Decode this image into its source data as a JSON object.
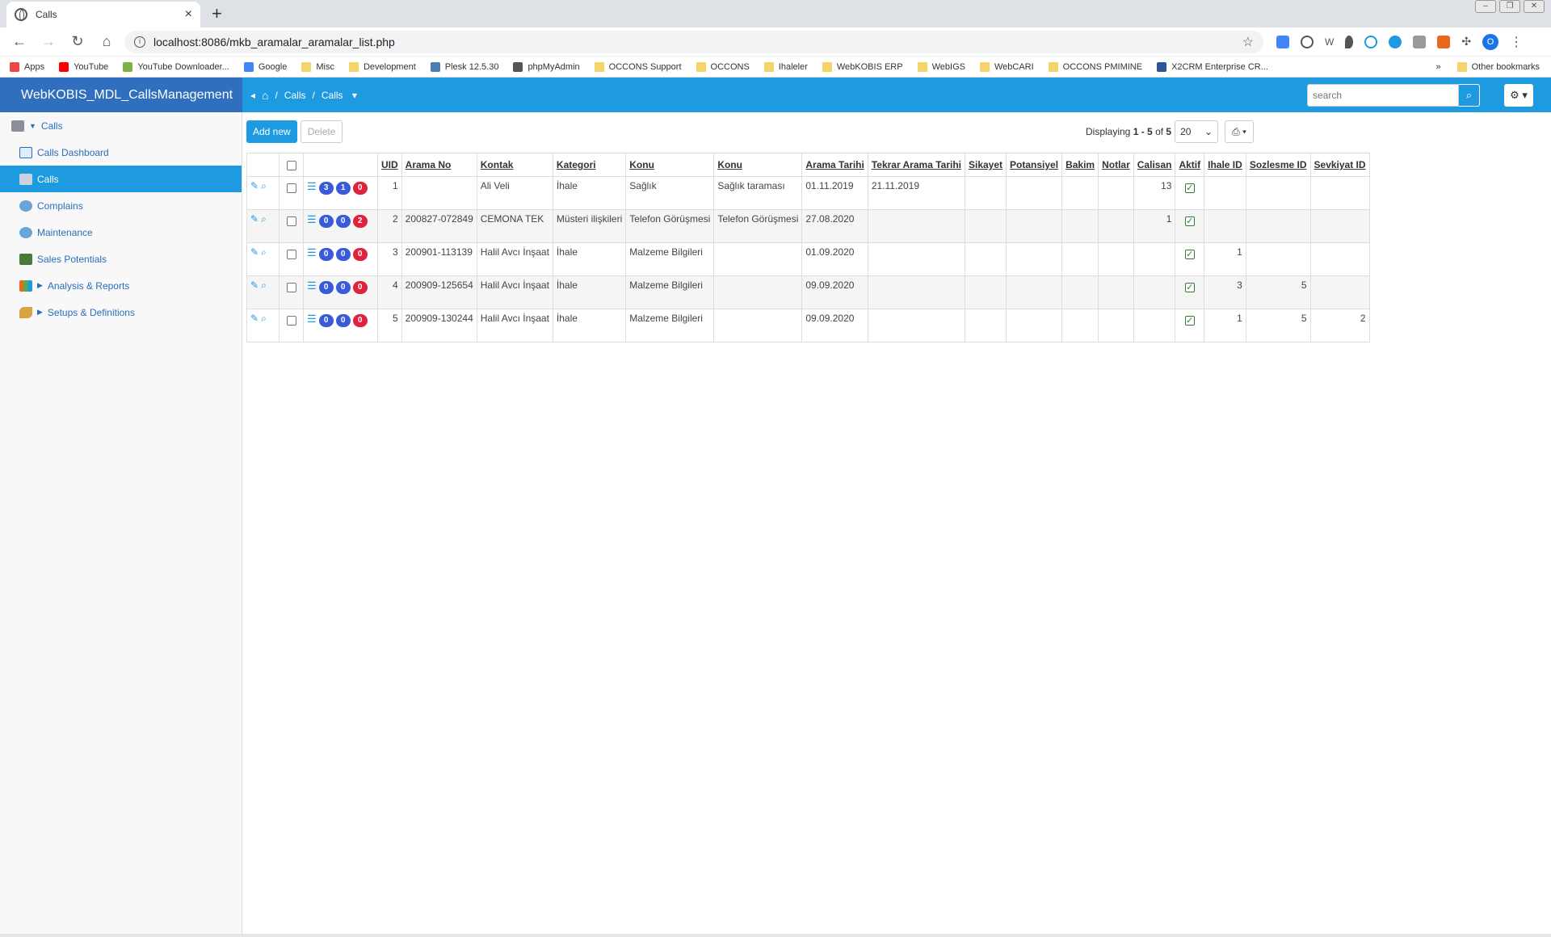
{
  "browser": {
    "tab_title": "Calls",
    "url": "localhost:8086/mkb_aramalar_aramalar_list.php",
    "bookmarks": [
      "Apps",
      "YouTube",
      "YouTube Downloader...",
      "Google",
      "Misc",
      "Development",
      "Plesk 12.5.30",
      "phpMyAdmin",
      "OCCONS Support",
      "OCCONS",
      "Ihaleler",
      "WebKOBIS ERP",
      "WebIGS",
      "WebCARI",
      "OCCONS PMIMINE",
      "X2CRM Enterprise CR..."
    ],
    "other_bookmarks": "Other bookmarks",
    "profile_initial": "O"
  },
  "app": {
    "brand": "WebKOBIS_MDL_CallsManagement",
    "breadcrumb": [
      "Calls",
      "Calls"
    ],
    "search_placeholder": "search"
  },
  "sidebar": {
    "items": [
      {
        "label": "Calls",
        "icon": "phone-icon",
        "expanded": true
      },
      {
        "label": "Calls Dashboard",
        "icon": "dashboard-icon"
      },
      {
        "label": "Calls",
        "icon": "calls-icon",
        "active": true
      },
      {
        "label": "Complains",
        "icon": "complains-icon"
      },
      {
        "label": "Maintenance",
        "icon": "maintenance-icon"
      },
      {
        "label": "Sales Potentials",
        "icon": "sales-icon"
      },
      {
        "label": "Analysis & Reports",
        "icon": "chart-icon"
      },
      {
        "label": "Setups & Definitions",
        "icon": "wrench-icon"
      }
    ]
  },
  "toolbar": {
    "add_label": "Add new",
    "delete_label": "Delete",
    "display_prefix": "Displaying",
    "display_range": "1 - 5",
    "display_of": "of",
    "display_total": "5",
    "page_size": "20"
  },
  "table": {
    "columns": [
      "UID",
      "Arama No",
      "Kontak",
      "Kategori",
      "Konu",
      "Konu",
      "Arama Tarihi",
      "Tekrar Arama Tarihi",
      "Sikayet",
      "Potansiyel",
      "Bakim",
      "Notlar",
      "Calisan",
      "Aktif",
      "Ihale ID",
      "Sozlesme ID",
      "Sevkiyat ID"
    ],
    "rows": [
      {
        "badges": [
          "3",
          "1",
          "0"
        ],
        "uid": "1",
        "arama_no": "",
        "kontak": "Ali Veli",
        "kategori": "İhale",
        "konu": "Sağlık",
        "konu2": "Sağlık taraması",
        "arama_tarihi": "01.11.2019",
        "tekrar": "21.11.2019",
        "sikayet": "",
        "potansiyel": "",
        "bakim": "",
        "notlar": "",
        "calisan": "13",
        "aktif": true,
        "ihale": "",
        "sozlesme": "",
        "sevkiyat": ""
      },
      {
        "badges": [
          "0",
          "0",
          "2"
        ],
        "uid": "2",
        "arama_no": "200827-072849",
        "kontak": "CEMONA TEK",
        "kategori": "Müsteri ilişkileri",
        "konu": "Telefon Görüşmesi",
        "konu2": "Telefon Görüşmesi",
        "arama_tarihi": "27.08.2020",
        "tekrar": "",
        "sikayet": "",
        "potansiyel": "",
        "bakim": "",
        "notlar": "",
        "calisan": "1",
        "aktif": true,
        "ihale": "",
        "sozlesme": "",
        "sevkiyat": ""
      },
      {
        "badges": [
          "0",
          "0",
          "0"
        ],
        "uid": "3",
        "arama_no": "200901-113139",
        "kontak": "Halil Avcı İnşaat",
        "kategori": "İhale",
        "konu": "Malzeme Bilgileri",
        "konu2": "",
        "arama_tarihi": "01.09.2020",
        "tekrar": "",
        "sikayet": "",
        "potansiyel": "",
        "bakim": "",
        "notlar": "",
        "calisan": "",
        "aktif": true,
        "ihale": "1",
        "sozlesme": "",
        "sevkiyat": ""
      },
      {
        "badges": [
          "0",
          "0",
          "0"
        ],
        "uid": "4",
        "arama_no": "200909-125654",
        "kontak": "Halil Avcı İnşaat",
        "kategori": "İhale",
        "konu": "Malzeme Bilgileri",
        "konu2": "",
        "arama_tarihi": "09.09.2020",
        "tekrar": "",
        "sikayet": "",
        "potansiyel": "",
        "bakim": "",
        "notlar": "",
        "calisan": "",
        "aktif": true,
        "ihale": "3",
        "sozlesme": "5",
        "sevkiyat": ""
      },
      {
        "badges": [
          "0",
          "0",
          "0"
        ],
        "uid": "5",
        "arama_no": "200909-130244",
        "kontak": "Halil Avcı İnşaat",
        "kategori": "İhale",
        "konu": "Malzeme Bilgileri",
        "konu2": "",
        "arama_tarihi": "09.09.2020",
        "tekrar": "",
        "sikayet": "",
        "potansiyel": "",
        "bakim": "",
        "notlar": "",
        "calisan": "",
        "aktif": true,
        "ihale": "1",
        "sozlesme": "5",
        "sevkiyat": "2"
      }
    ]
  },
  "colors": {
    "accent": "#1e9ae0",
    "brand": "#2f6fbd",
    "badge_blue": "#3a5bd9",
    "badge_red": "#e0223d"
  }
}
